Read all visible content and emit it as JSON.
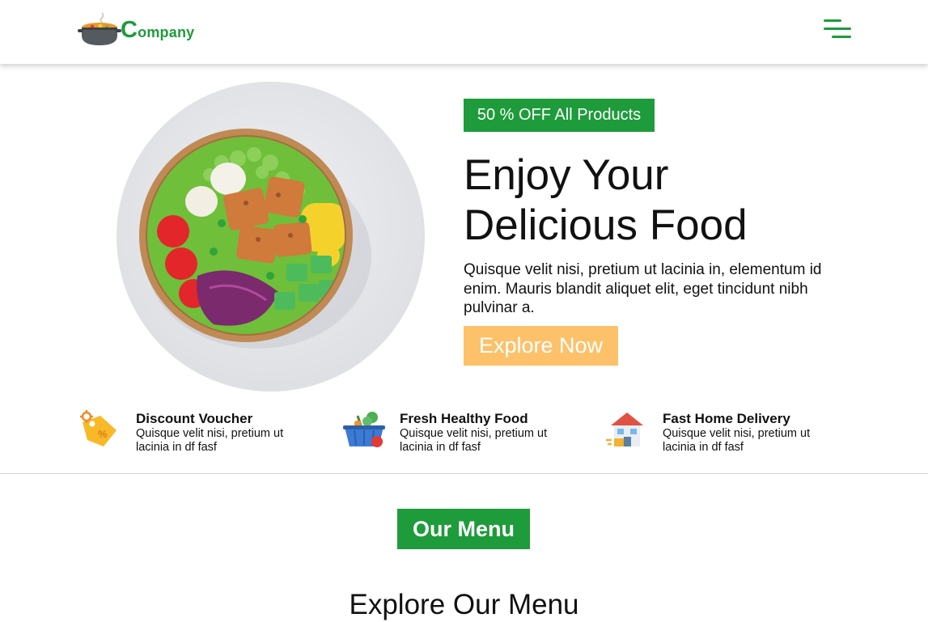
{
  "header": {
    "logo": {
      "initial": "C",
      "rest": "ompany",
      "icon": "cooking-pot-icon"
    },
    "menu_icon": "hamburger-menu-icon"
  },
  "hero": {
    "badge": "50 % OFF All Products",
    "title_line1": "Enjoy Your",
    "title_line2": "Delicious Food",
    "description": "Quisque velit nisi, pretium ut lacinia in, elementum id enim. Mauris blandit aliquet elit, eget tincidunt nibh pulvinar a.",
    "cta_label": "Explore Now",
    "image": "salad-bowl-image"
  },
  "features": [
    {
      "title": "Discount Voucher",
      "description": "Quisque velit nisi, pretium ut lacinia in df fasf",
      "icon": "discount-tag-icon"
    },
    {
      "title": "Fresh Healthy Food",
      "description": "Quisque velit nisi, pretium ut lacinia in df fasf",
      "icon": "vegetable-basket-icon"
    },
    {
      "title": "Fast Home Delivery",
      "description": "Quisque velit nisi, pretium ut lacinia in df fasf",
      "icon": "home-delivery-icon"
    }
  ],
  "menu_section": {
    "badge": "Our Menu",
    "title": "Explore Our Menu"
  },
  "colors": {
    "brand_green": "#1e9b3a",
    "cta_orange": "#fdc16a",
    "text": "#111111"
  }
}
